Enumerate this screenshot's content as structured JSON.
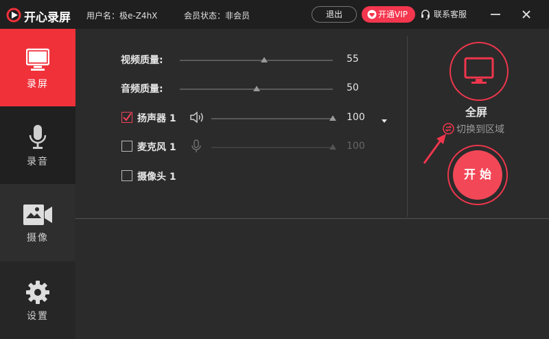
{
  "titlebar": {
    "app_name": "开心录屏",
    "username": "用户名：极e-Z4hX",
    "member_status": "会员状态：非会员",
    "logout_label": "退出",
    "vip_label": "开通VIP",
    "support_label": "联系客服"
  },
  "sidebar": {
    "items": [
      {
        "label": "录屏",
        "icon": "monitor-icon",
        "active": true
      },
      {
        "label": "录音",
        "icon": "microphone-icon",
        "active": false
      },
      {
        "label": "摄像",
        "icon": "video-camera-icon",
        "active": false
      },
      {
        "label": "设置",
        "icon": "gear-icon",
        "active": false
      }
    ]
  },
  "settings": {
    "video_quality": {
      "label": "视频质量:",
      "value": "55",
      "level": 55
    },
    "audio_quality": {
      "label": "音频质量:",
      "value": "50",
      "level": 50
    },
    "speaker": {
      "label": "扬声器 1",
      "checked": true,
      "value": "100",
      "level": 100
    },
    "microphone": {
      "label": "麦克风 1",
      "checked": false,
      "value": "100",
      "level": 100,
      "disabled": true
    },
    "camera": {
      "label": "摄像头 1",
      "checked": false
    }
  },
  "capture": {
    "mode_label": "全屏",
    "switch_label": "切换到区域",
    "start_label": "开始"
  },
  "colors": {
    "accent": "#f0313a",
    "vip": "#f4364e",
    "start": "#f24757"
  }
}
